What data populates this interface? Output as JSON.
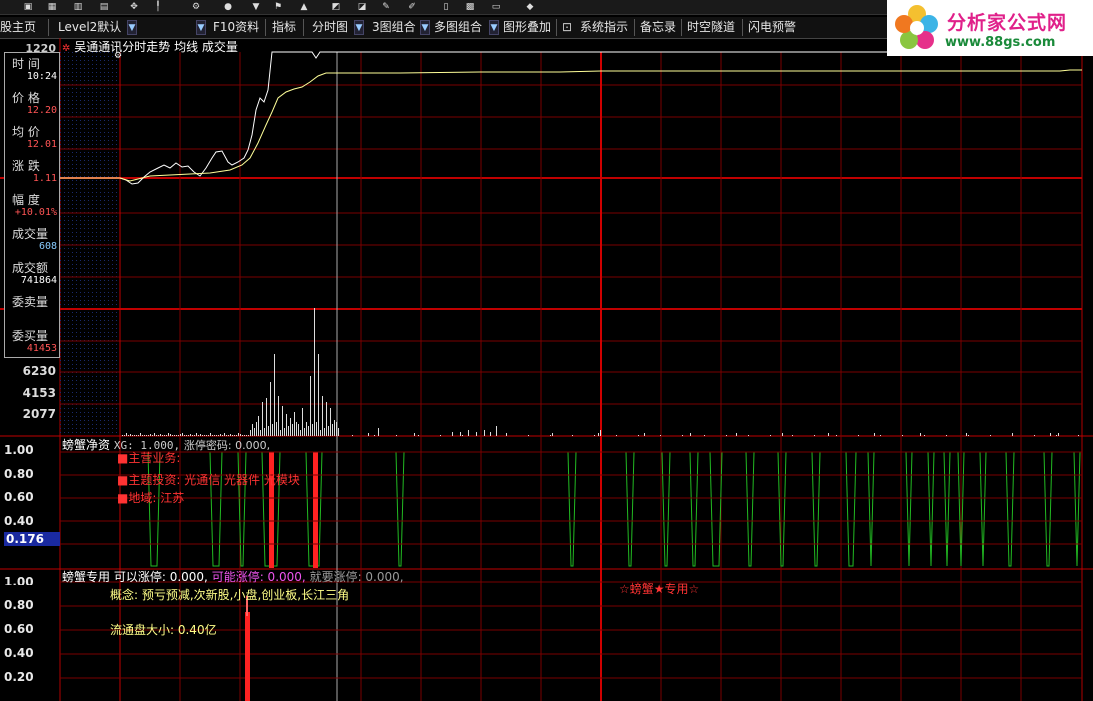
{
  "toolbar": {
    "items": [
      "股主页",
      "Level2默认",
      "F10资料",
      "指标",
      "分时图",
      "3图组合",
      "多图组合",
      "图形叠加",
      "系统指示",
      "备忘录",
      "时空隧道",
      "闪电预警"
    ]
  },
  "logo": {
    "name": "分析家公式网",
    "url": "www.88gs.com"
  },
  "chart_header": {
    "stock": "吴通通讯",
    "mode": "分时走势",
    "series1": "均线",
    "series2": "成交量"
  },
  "price_axis": {
    "top_label": "1220"
  },
  "infobox": {
    "rows": [
      {
        "label": "时 间",
        "value": "10:24",
        "color": "#ffffff"
      },
      {
        "label": "价 格",
        "value": "12.20",
        "color": "#ff5555"
      },
      {
        "label": "均 价",
        "value": "12.01",
        "color": "#ff5555"
      },
      {
        "label": "涨 跌",
        "value": "1.11",
        "color": "#ff5555"
      },
      {
        "label": "幅 度",
        "value": "+10.01%",
        "color": "#ff5555"
      },
      {
        "label": "成交量",
        "value": "608",
        "color": "#88ccff"
      },
      {
        "label": "成交额",
        "value": "741864",
        "color": "#ffffff"
      },
      {
        "label": "委卖量",
        "value": "",
        "color": "#ffffff"
      },
      {
        "label": "委买量",
        "value": "41453",
        "color": "#ff5555"
      }
    ]
  },
  "volume_axis": {
    "labels": [
      "6230",
      "4153",
      "2077"
    ]
  },
  "indicator1": {
    "name": "螃蟹净资",
    "xg": "XG: 1.000,",
    "zt": "涨停密码: 0.000,",
    "lines": [
      "主营业务:",
      "主题投资: 光通信 光器件 光模块",
      "地域: 江苏"
    ],
    "y_labels": [
      "1.00",
      "0.80",
      "0.60",
      "0.40",
      "0.20"
    ],
    "cursor_value": "0.176"
  },
  "indicator2": {
    "name": "螃蟹专用",
    "v1": "可以涨停: 0.000,",
    "v2": "可能涨停: 0.000,",
    "v3": "就要涨停: 0.000,",
    "concept": "概念: 预亏预减,次新股,小盘,创业板,长江三角",
    "float": "流通盘大小: 0.40亿",
    "tag": "☆螃蟹★专用☆",
    "y_labels": [
      "1.00",
      "0.80",
      "0.60",
      "0.40",
      "0.20"
    ]
  },
  "colors": {
    "grid_red": "#8b0000",
    "axis_red": "#c00000",
    "price_line": "#ffffff",
    "avg_line": "#ffff99",
    "signal_green": "#22bb22",
    "signal_red": "#ff2222"
  }
}
